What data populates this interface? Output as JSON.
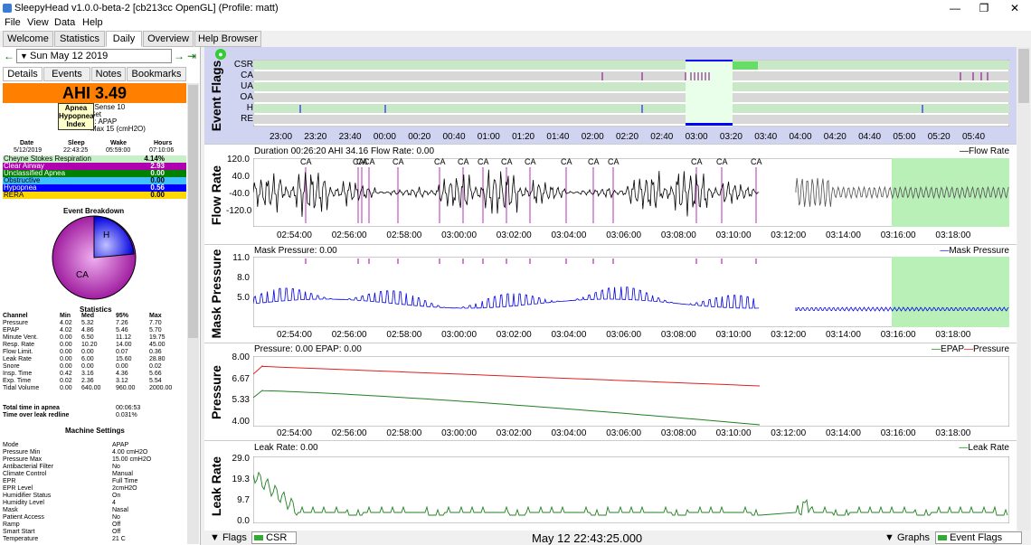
{
  "window": {
    "title": "SleepyHead v1.0.0-beta-2 [cb213cc OpenGL] (Profile: matt)"
  },
  "menu": [
    "File",
    "View",
    "Data",
    "Help"
  ],
  "main_tabs": [
    "Welcome",
    "Statistics",
    "Daily",
    "Overview",
    "Help Browser"
  ],
  "date_nav": {
    "date": "Sun May 12 2019"
  },
  "side_tabs": [
    "Details",
    "Events",
    "Notes",
    "Bookmarks"
  ],
  "ahi": {
    "label": "AHI 3.49"
  },
  "tooltip": {
    "text": "Apnea Hypopnea Index"
  },
  "machine_info": {
    "l1": "eSense 10",
    "l2": "Set",
    "l3": "e: APAP",
    "l4": "Max 15 (cmH2O)"
  },
  "session": {
    "headers": [
      "Date",
      "Sleep",
      "Wake",
      "Hours"
    ],
    "values": [
      "5/12/2019",
      "22:43:25",
      "05:59:00",
      "07:10:06"
    ]
  },
  "events": [
    {
      "name": "Cheyne Stokes Respiration",
      "value": "4.14%",
      "color": "#c8f0c8"
    },
    {
      "name": "Clear Airway",
      "value": "2.93",
      "color": "#b000b0"
    },
    {
      "name": "Unclassified Apnea",
      "value": "0.00",
      "color": "#008000"
    },
    {
      "name": "Obstructive",
      "value": "0.00",
      "color": "#40c0ff"
    },
    {
      "name": "Hypopnea",
      "value": "0.56",
      "color": "#0000ff"
    },
    {
      "name": "RERA",
      "value": "0.00",
      "color": "#ffd700"
    }
  ],
  "breakdown": {
    "title": "Event Breakdown",
    "labels": [
      "H",
      "CA"
    ]
  },
  "statistics": {
    "title": "Statistics",
    "headers": [
      "Channel",
      "Min",
      "Med",
      "95%",
      "Max"
    ],
    "rows": [
      [
        "Pressure",
        "4.02",
        "5.32",
        "7.26",
        "7.70"
      ],
      [
        "EPAP",
        "4.02",
        "4.86",
        "5.46",
        "5.70"
      ],
      [
        "Minute Vent.",
        "0.00",
        "6.50",
        "11.12",
        "19.75"
      ],
      [
        "Resp. Rate",
        "0.00",
        "10.20",
        "14.00",
        "45.00"
      ],
      [
        "Flow Limit.",
        "0.00",
        "0.00",
        "0.07",
        "0.36"
      ],
      [
        "Leak Rate",
        "0.00",
        "6.00",
        "15.60",
        "28.80"
      ],
      [
        "Snore",
        "0.00",
        "0.00",
        "0.00",
        "0.02"
      ],
      [
        "Insp. Time",
        "0.42",
        "3.16",
        "4.36",
        "5.66"
      ],
      [
        "Exp. Time",
        "0.02",
        "2.36",
        "3.12",
        "5.54"
      ],
      [
        "Tidal Volume",
        "0.00",
        "640.00",
        "960.00",
        "2000.00"
      ]
    ],
    "apnea_label": "Total time in apnea",
    "apnea_val": "00:06:53",
    "leak_label": "Time over leak redline",
    "leak_val": "0.031%"
  },
  "machine_settings": {
    "title": "Machine Settings",
    "rows": [
      [
        "Mode",
        "APAP"
      ],
      [
        "Pressure Min",
        "4.00 cmH2O"
      ],
      [
        "Pressure Max",
        "15.00 cmH2O"
      ],
      [
        "Antibacterial Filter",
        "No"
      ],
      [
        "Climate Control",
        "Manual"
      ],
      [
        "EPR",
        "Full Time"
      ],
      [
        "EPR Level",
        "2cmH2O"
      ],
      [
        "Humidifier Status",
        "On"
      ],
      [
        "Humidity Level",
        "4"
      ],
      [
        "Mask",
        "Nasal"
      ],
      [
        "Patient Access",
        "No"
      ],
      [
        "Ramp",
        "Off"
      ],
      [
        "Smart Start",
        "Off"
      ],
      [
        "Temperature",
        "21 C"
      ]
    ]
  },
  "flags_graph": {
    "label": "Event Flags",
    "rows": [
      "CSR",
      "CA",
      "UA",
      "OA",
      "H",
      "RE"
    ],
    "ticks": [
      "23:00",
      "23:20",
      "23:40",
      "00:00",
      "00:20",
      "00:40",
      "01:00",
      "01:20",
      "01:40",
      "02:00",
      "02:20",
      "02:40",
      "03:00",
      "03:20",
      "03:40",
      "04:00",
      "04:20",
      "04:40",
      "05:00",
      "05:20",
      "05:40"
    ]
  },
  "x_ticks": [
    "02:54:00",
    "02:56:00",
    "02:58:00",
    "03:00:00",
    "03:02:00",
    "03:04:00",
    "03:06:00",
    "03:08:00",
    "03:10:00",
    "03:12:00",
    "03:14:00",
    "03:16:00",
    "03:18:00"
  ],
  "flow": {
    "label": "Flow Rate",
    "info": "Duration 00:26:20 AHI 34.16 Flow Rate: 0.00",
    "legend": "Flow Rate",
    "yticks": [
      "120.0",
      "40.0",
      "-40.0",
      "-120.0"
    ],
    "ca_marks": [
      "CA",
      "CA",
      "CA",
      "CA",
      "CA",
      "CA",
      "CA",
      "CA",
      "CA",
      "CA",
      "CA",
      "CA",
      "CA",
      "CA",
      "CA",
      "CA",
      "CA"
    ]
  },
  "mask": {
    "label": "Mask Pressure",
    "info": "Mask Pressure: 0.00",
    "legend": "Mask Pressure",
    "yticks": [
      "11.0",
      "8.0",
      "5.0"
    ]
  },
  "pressure": {
    "label": "Pressure",
    "info": "Pressure: 0.00 EPAP: 0.00",
    "legend_epap": "EPAP",
    "legend_pressure": "Pressure",
    "yticks": [
      "8.00",
      "6.67",
      "5.33",
      "4.00"
    ]
  },
  "leak": {
    "label": "Leak Rate",
    "info": "Leak Rate: 0.00",
    "legend": "Leak Rate",
    "yticks": [
      "29.0",
      "19.3",
      "9.7",
      "0.0"
    ]
  },
  "bottom": {
    "flags": "Flags",
    "csr": "CSR",
    "time": "May 12 22:43:25.000",
    "graphs": "Graphs",
    "event_flags": "Event Flags"
  }
}
